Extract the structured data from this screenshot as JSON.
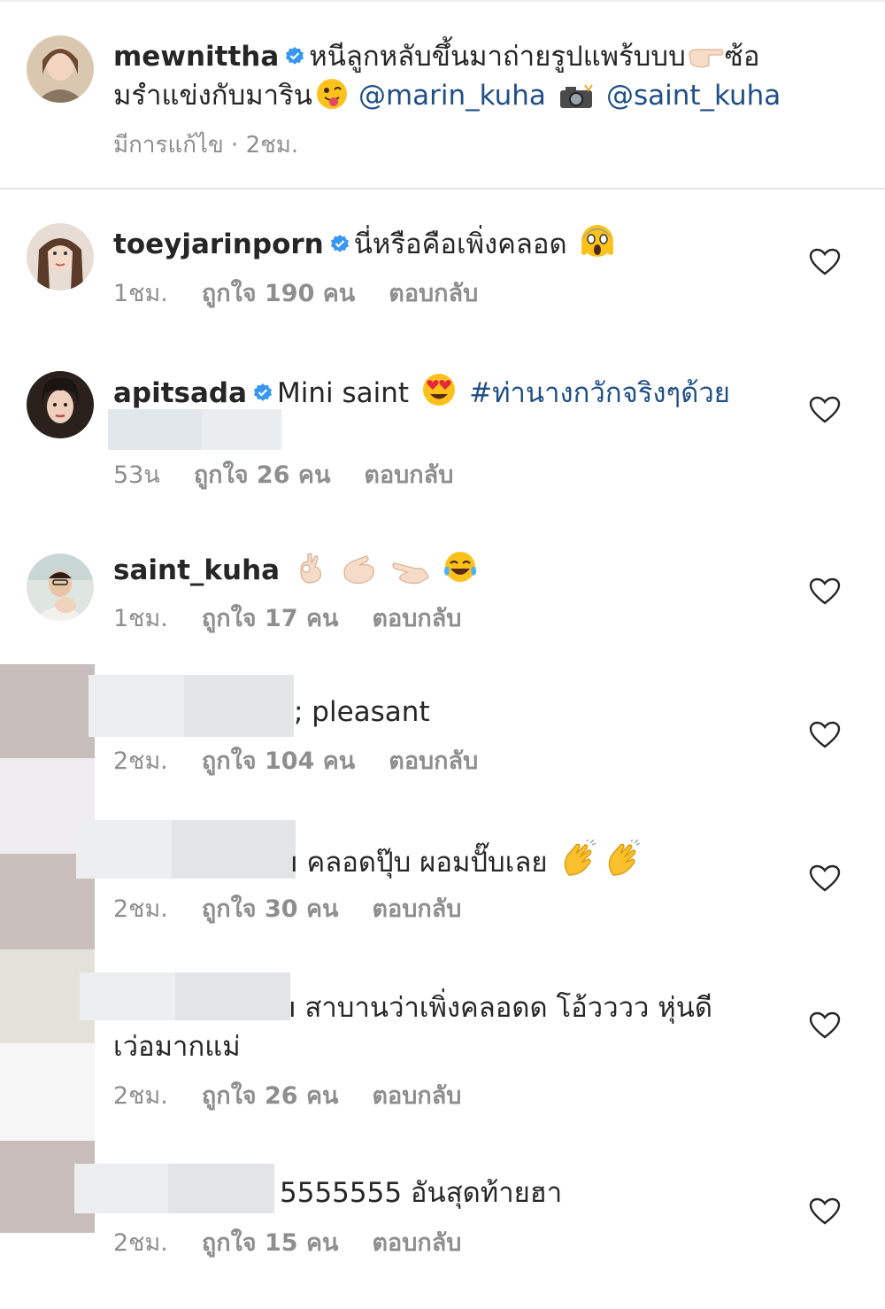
{
  "caption": {
    "username": "mewnittha",
    "text_line1": "หนีลูกหลับขึ้นมาถ่ายรูปแพร้บบบ",
    "text_line1_tail": "ซ้อ",
    "text_line2": "มรำแข่งกับมาริน",
    "mention1": "@marin_kuha",
    "mention2": "@saint_kuha",
    "meta": "มีการแก้ไข · 2ชม."
  },
  "comments": [
    {
      "username": "toeyjarinporn",
      "verified": true,
      "text": "นี่หรือคือเพิ่งคลอด",
      "time": "1ชม.",
      "likes": "ถูกใจ 190 คน",
      "reply": "ตอบกลับ"
    },
    {
      "username": "apitsada",
      "verified": true,
      "text": "Mini saint",
      "hashtag": "#ท่านางกวักจริงๆด้วย",
      "time": "53น",
      "likes": "ถูกใจ 26 คน",
      "reply": "ตอบกลับ"
    },
    {
      "username": "saint_kuha",
      "verified": false,
      "text": "",
      "time": "1ชม.",
      "likes": "ถูกใจ 17 คน",
      "reply": "ตอบกลับ"
    },
    {
      "username": "",
      "text": "; pleasant",
      "time": "2ชม.",
      "likes": "ถูกใจ 104 คน",
      "reply": "ตอบกลับ"
    },
    {
      "username": "",
      "text": "ı คลอดปุ๊บ ผอมปั๊บเลย",
      "time": "2ชม.",
      "likes": "ถูกใจ 30 คน",
      "reply": "ตอบกลับ"
    },
    {
      "username": "",
      "text": "ı สาบานว่าเพิ่งคลอดด โอ้วววว หุ่นดี",
      "text_line2": "เว่อมากแม่",
      "time": "2ชม.",
      "likes": "ถูกใจ 26 คน",
      "reply": "ตอบกลับ"
    },
    {
      "username": "",
      "text": "5555555 อันสุดท้ายฮา",
      "time": "2ชม.",
      "likes": "ถูกใจ 15 คน",
      "reply": "ตอบกลับ"
    }
  ],
  "colors": {
    "mention": "#1f4f86",
    "meta": "#8e8e8e",
    "verified": "#3897f0"
  },
  "icons": [
    "verified-badge-icon",
    "heart-icon",
    "emoji"
  ]
}
